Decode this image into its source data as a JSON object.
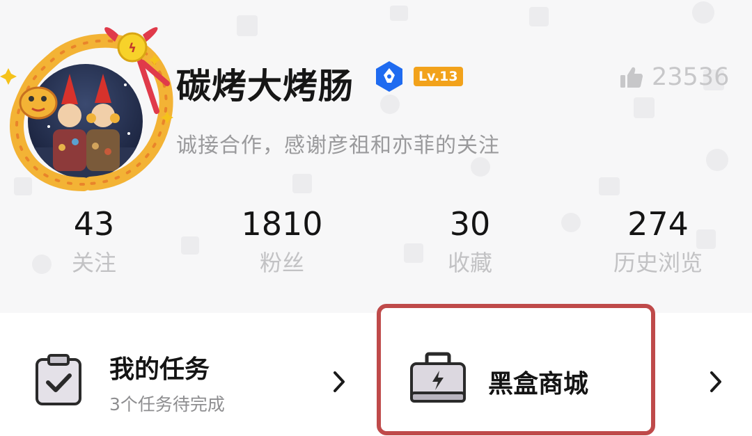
{
  "profile": {
    "username": "碳烤大烤肠",
    "level": "Lv.13",
    "likes": "23536",
    "bio": "诚接合作，感谢彦祖和亦菲的关注",
    "icons": {
      "avatar": "avatar-icon",
      "verify": "verified-badge-icon",
      "likes": "thumbs-up-icon"
    }
  },
  "stats": [
    {
      "value": "43",
      "label": "关注"
    },
    {
      "value": "1810",
      "label": "粉丝"
    },
    {
      "value": "30",
      "label": "收藏"
    },
    {
      "value": "274",
      "label": "历史浏览"
    }
  ],
  "tasks": {
    "title": "我的任务",
    "subtitle": "3个任务待完成",
    "icon": "clipboard-check-icon"
  },
  "shop": {
    "title": "黑盒商城",
    "icon": "toolbox-icon"
  },
  "colors": {
    "level_badge": "#f2a21b",
    "verify_badge": "#1f6bf0",
    "highlight_border": "#bf4a4a",
    "muted_text": "#9a9a9c"
  }
}
